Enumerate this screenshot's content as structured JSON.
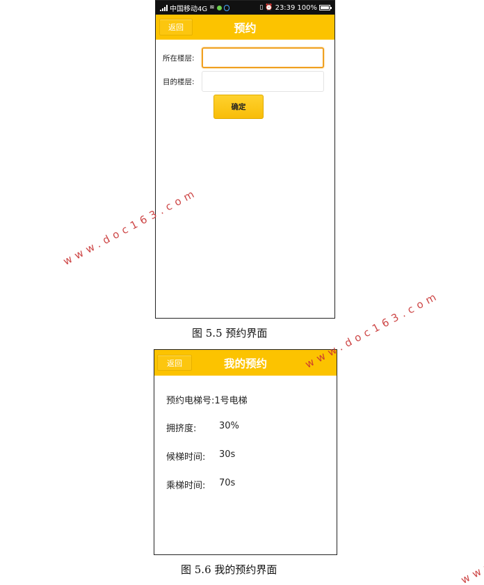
{
  "screen1": {
    "statusbar": {
      "carrier": "中国移动4G",
      "time": "23:39",
      "battery": "100%"
    },
    "header": {
      "back_label": "返回",
      "title": "预约"
    },
    "form": {
      "current_floor_label": "所在楼层:",
      "current_floor_value": "",
      "target_floor_label": "目的楼层:",
      "target_floor_value": "",
      "confirm_label": "确定"
    },
    "caption": "图 5.5  预约界面"
  },
  "screen2": {
    "header": {
      "back_label": "返回",
      "title": "我的预约"
    },
    "info": {
      "elevator": "预约电梯号:1号电梯",
      "crowd_label": "拥挤度:",
      "crowd_value": "30%",
      "wait_label": "候梯时间:",
      "wait_value": "30s",
      "ride_label": "乘梯时间:",
      "ride_value": "70s"
    },
    "caption": "图 5.6 我的预约界面"
  },
  "watermark": {
    "text": "www.doc163.com",
    "partial_text": "www."
  },
  "colors": {
    "header": "#fcc300",
    "input_focus": "#f0a020",
    "watermark": "#c83232"
  }
}
